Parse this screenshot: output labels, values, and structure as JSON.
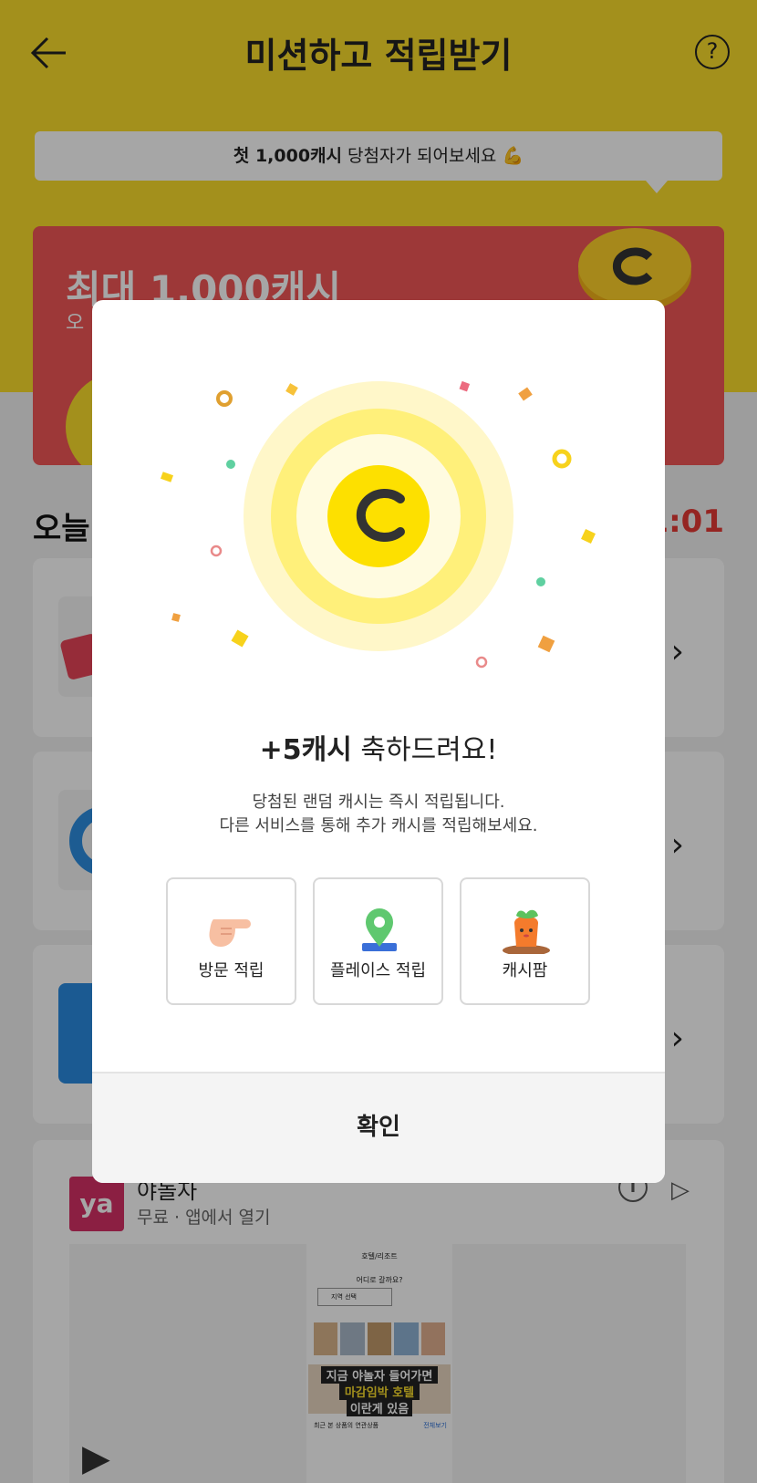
{
  "header": {
    "title": "미션하고 적립받기",
    "back_icon": "arrow-left-icon",
    "help_label": "?"
  },
  "tooltip": {
    "prefix": "첫 1,000캐시",
    "suffix": " 당첨자가 되어보세요 💪"
  },
  "promo": {
    "title": "최대 1,000캐시",
    "subtitle": "오",
    "color": "#f25757"
  },
  "missions": {
    "section_title": "오늘",
    "timer": "1:01"
  },
  "ad": {
    "logo": "ya",
    "name": "야놀자",
    "subtitle": "무료 · 앱에서 열기",
    "info_label": "i",
    "phone_title": "호텔/리조트",
    "phone_question": "어디로 갈까요?",
    "phone_search": "지역 선택",
    "banner_line1": "지금 야놀자 들어가면",
    "banner_line2": "마감임박 호텔",
    "banner_line3": "이란게 있음",
    "recent_label": "최근 본 상품의 연관상품",
    "more_label": "전체보기"
  },
  "modal": {
    "title_bold": "+5캐시",
    "title_rest": " 축하드려요!",
    "desc_line1": "당첨된 랜덤 캐시는 즉시 적립됩니다.",
    "desc_line2": "다른 서비스를 통해 추가 캐시를 적립해보세요.",
    "options": [
      {
        "label": "방문 적립",
        "icon": "pointing-hand-icon"
      },
      {
        "label": "플레이스 적립",
        "icon": "map-pin-icon"
      },
      {
        "label": "캐시팜",
        "icon": "carrot-icon"
      }
    ],
    "confirm_label": "확인",
    "accent_color": "#fde000"
  }
}
